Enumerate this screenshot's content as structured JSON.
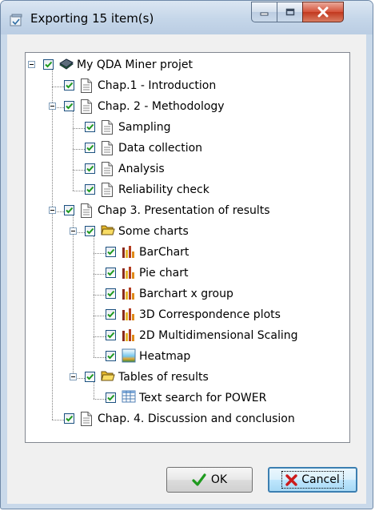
{
  "window": {
    "title": "Exporting 15 item(s)",
    "controls": {
      "minimize": "minimize",
      "maximize": "maximize",
      "close": "close"
    }
  },
  "tree": {
    "items": [
      {
        "label": "My QDA Miner projet",
        "icon": "book-icon",
        "checked": true,
        "expanded": true,
        "level": 0
      },
      {
        "label": "Chap.1 - Introduction",
        "icon": "document-icon",
        "checked": true,
        "level": 1
      },
      {
        "label": "Chap. 2 - Methodology",
        "icon": "document-icon",
        "checked": true,
        "expanded": true,
        "level": 1
      },
      {
        "label": "Sampling",
        "icon": "document-icon",
        "checked": true,
        "level": 2
      },
      {
        "label": "Data collection",
        "icon": "document-icon",
        "checked": true,
        "level": 2
      },
      {
        "label": "Analysis",
        "icon": "document-icon",
        "checked": true,
        "level": 2
      },
      {
        "label": "Reliability check",
        "icon": "document-icon",
        "checked": true,
        "level": 2
      },
      {
        "label": "Chap 3. Presentation of results",
        "icon": "document-icon",
        "checked": true,
        "expanded": true,
        "level": 1
      },
      {
        "label": "Some charts",
        "icon": "folder-icon",
        "checked": true,
        "expanded": true,
        "level": 2
      },
      {
        "label": "BarChart",
        "icon": "bar-chart-icon",
        "checked": true,
        "level": 3
      },
      {
        "label": "Pie chart",
        "icon": "bar-chart-icon",
        "checked": true,
        "level": 3
      },
      {
        "label": "Barchart x group",
        "icon": "bar-chart-icon",
        "checked": true,
        "level": 3
      },
      {
        "label": "3D Correspondence plots",
        "icon": "bar-chart-icon",
        "checked": true,
        "level": 3
      },
      {
        "label": "2D Multidimensional Scaling",
        "icon": "bar-chart-icon",
        "checked": true,
        "level": 3
      },
      {
        "label": "Heatmap",
        "icon": "heatmap-icon",
        "checked": true,
        "level": 3
      },
      {
        "label": "Tables of results",
        "icon": "folder-icon",
        "checked": true,
        "expanded": true,
        "level": 2
      },
      {
        "label": "Text search for POWER",
        "icon": "table-icon",
        "checked": true,
        "level": 3
      },
      {
        "label": "Chap. 4. Discussion and conclusion",
        "icon": "document-icon",
        "checked": true,
        "level": 1
      }
    ]
  },
  "buttons": {
    "ok": "OK",
    "cancel": "Cancel"
  },
  "colors": {
    "check": "#1e9a1e",
    "cancel_x": "#cc1c1c"
  }
}
